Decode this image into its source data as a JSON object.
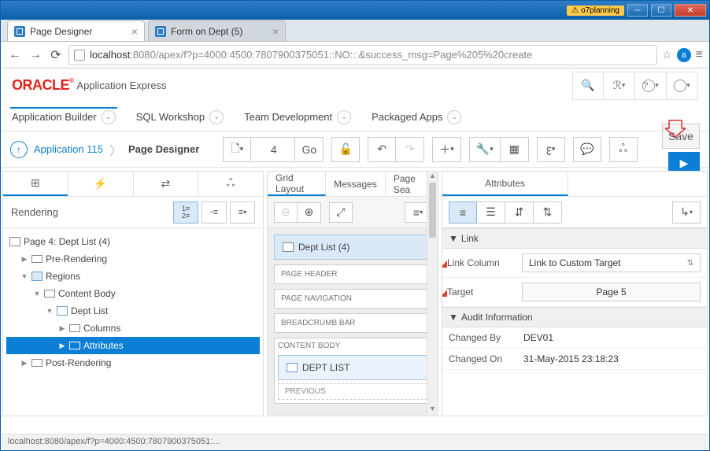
{
  "window": {
    "warn": "o7planning"
  },
  "browser": {
    "tabs": [
      {
        "title": "Page Designer"
      },
      {
        "title": "Form on Dept (5)"
      }
    ],
    "url_host": "localhost",
    "url_path": ":8080/apex/f?p=4000:4500:7807900375051::NO:::&success_msg=Page%205%20create"
  },
  "app": {
    "brand": "ORACLE",
    "brand_suffix": "Application Express",
    "menu": [
      "Application Builder",
      "SQL Workshop",
      "Team Development",
      "Packaged Apps"
    ]
  },
  "toolbar": {
    "bc_app": "Application 115",
    "bc_cur": "Page Designer",
    "page_num": "4",
    "go": "Go",
    "save": "Save"
  },
  "left": {
    "title": "Rendering",
    "tree": {
      "root": "Page 4: Dept List (4)",
      "pre": "Pre-Rendering",
      "regions": "Regions",
      "content_body": "Content Body",
      "dept_list": "Dept List",
      "columns": "Columns",
      "attributes": "Attributes",
      "post": "Post-Rendering"
    }
  },
  "mid": {
    "tabs": [
      "Grid Layout",
      "Messages",
      "Page Sea"
    ],
    "region": "Dept List (4)",
    "sections": [
      "PAGE HEADER",
      "PAGE NAVIGATION",
      "BREADCRUMB BAR",
      "CONTENT BODY"
    ],
    "nested_region": "Dept List",
    "nested_sub": "PREVIOUS"
  },
  "right": {
    "tab": "Attributes",
    "sections": {
      "link": "Link",
      "audit": "Audit Information"
    },
    "props": {
      "link_column_l": "Link Column",
      "link_column_v": "Link to Custom Target",
      "target_l": "Target",
      "target_v": "Page 5",
      "changed_by_l": "Changed By",
      "changed_by_v": "DEV01",
      "changed_on_l": "Changed On",
      "changed_on_v": "31-May-2015 23:18:23"
    }
  },
  "status": "localhost:8080/apex/f?p=4000:4500:7807900375051:..."
}
